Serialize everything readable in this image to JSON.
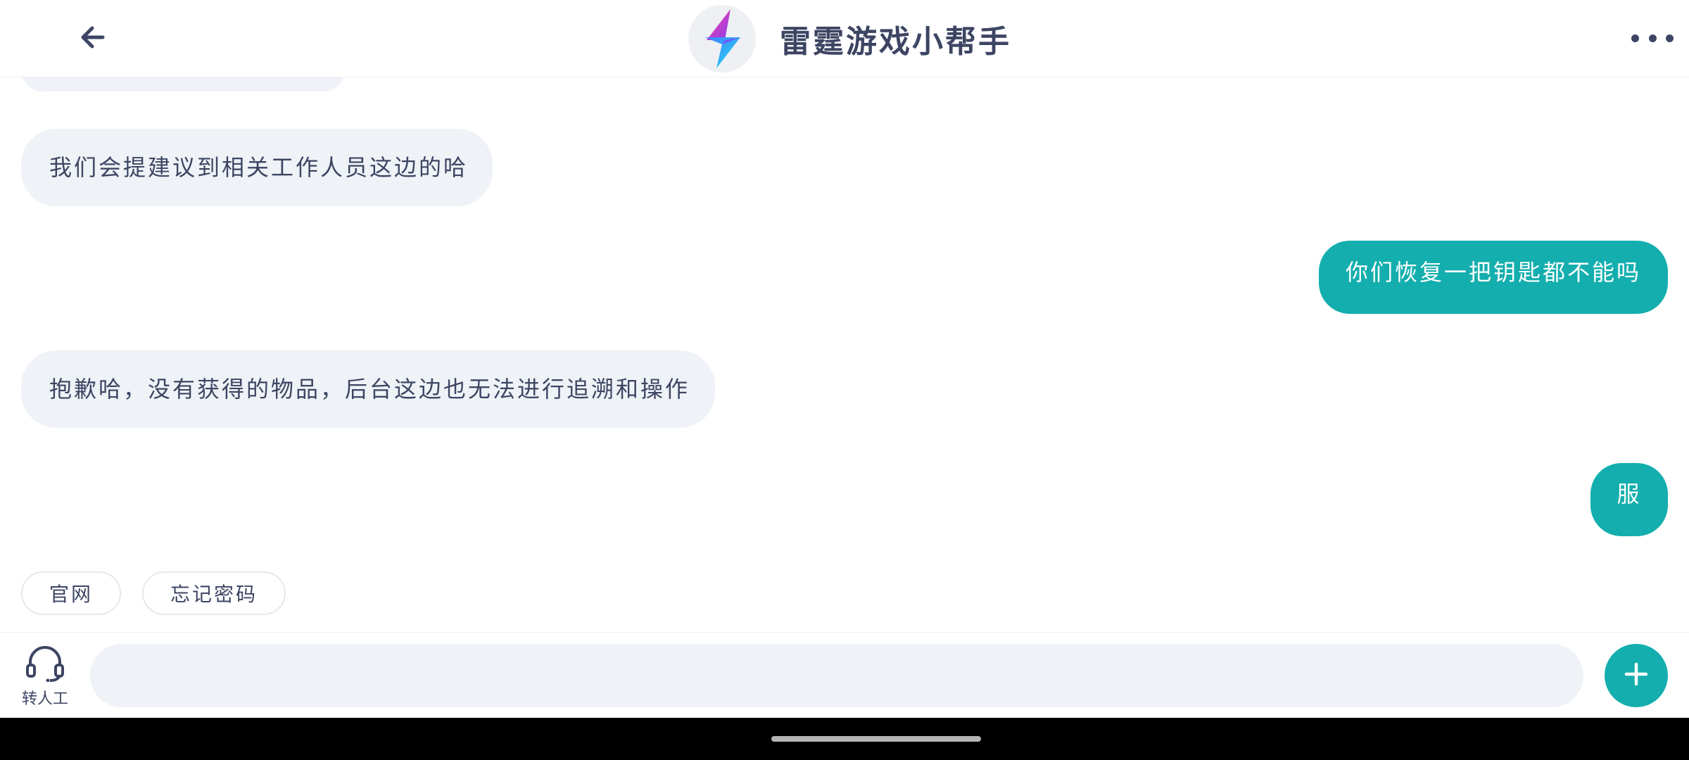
{
  "header": {
    "title": "雷霆游戏小帮手",
    "back_icon": "arrow-left-icon",
    "more_icon": "more-dots-icon",
    "logo_icon": "thunder-bolt-logo"
  },
  "messages": [
    {
      "side": "in",
      "text": "我们会提建议到相关工作人员这边的哈"
    },
    {
      "side": "out",
      "text": "你们恢复一把钥匙都不能吗"
    },
    {
      "side": "in",
      "text": "抱歉哈，没有获得的物品，后台这边也无法进行追溯和操作"
    },
    {
      "side": "out",
      "text": "服"
    }
  ],
  "quick_replies": [
    "官网",
    "忘记密码"
  ],
  "input": {
    "human_label": "转人工",
    "placeholder": "",
    "human_icon": "headset-icon",
    "plus_icon": "plus-icon"
  },
  "colors": {
    "accent": "#14aeae",
    "incoming_bubble": "#eff2f6",
    "text": "#3d4563"
  }
}
